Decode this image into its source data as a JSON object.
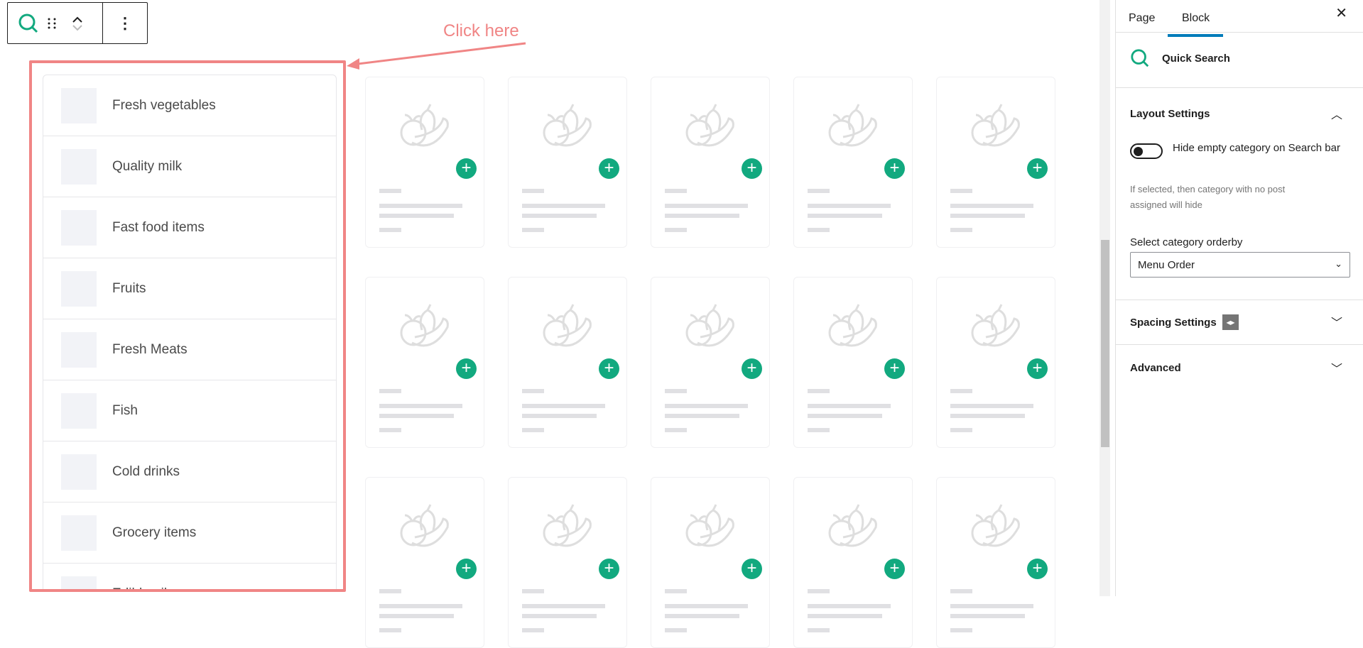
{
  "toolbar": {
    "block_icon": "search-icon",
    "drag_icon": "drag-handle-icon",
    "move_up_icon": "chevron-up-icon",
    "move_down_icon": "chevron-down-icon",
    "options_icon": "more-vertical-icon",
    "options": "⋮"
  },
  "annotation": {
    "text": "Click here",
    "color": "#f08585"
  },
  "categories": [
    "Fresh vegetables",
    "Quality milk",
    "Fast food items",
    "Fruits",
    "Fresh Meats",
    "Fish",
    "Cold drinks",
    "Grocery items",
    "Edible oils"
  ],
  "product_placeholder": {
    "icon": "fruit-icon",
    "add_icon": "plus-icon",
    "accent": "#12a97f",
    "rows": 3,
    "columns": 5
  },
  "sidebar": {
    "tabs": [
      {
        "label": "Page"
      },
      {
        "label": "Block",
        "active": true
      }
    ],
    "close": "✕",
    "block_name": "Quick Search",
    "layout": {
      "title": "Layout Settings",
      "toggle_label": "Hide empty category on Search bar",
      "toggle_on": false,
      "help": "If selected, then category with no post assigned will hide",
      "select_label": "Select category orderby",
      "select_value": "Menu Order"
    },
    "spacing": {
      "title": "Spacing Settings"
    },
    "advanced": {
      "title": "Advanced"
    }
  }
}
